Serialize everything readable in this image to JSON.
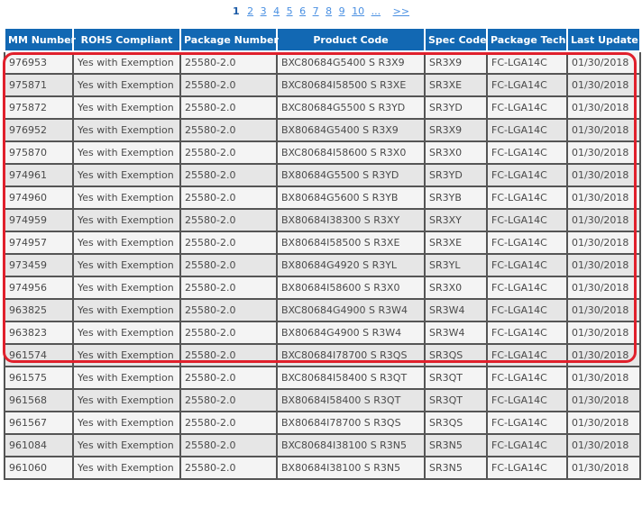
{
  "pagination": {
    "current": "1",
    "pages": [
      "2",
      "3",
      "4",
      "5",
      "6",
      "7",
      "8",
      "9",
      "10"
    ],
    "ellipsis": "...",
    "next": ">>"
  },
  "table": {
    "headers": [
      "MM Number",
      "ROHS Compliant",
      "Package Number",
      "Product Code",
      "Spec Code",
      "Package Tech",
      "Last Update"
    ],
    "rows": [
      [
        "976953",
        "Yes with Exemption",
        "25580-2.0",
        "BXC80684G5400 S R3X9",
        "SR3X9",
        "FC-LGA14C",
        "01/30/2018"
      ],
      [
        "975871",
        "Yes with Exemption",
        "25580-2.0",
        "BXC80684I58500 S R3XE",
        "SR3XE",
        "FC-LGA14C",
        "01/30/2018"
      ],
      [
        "975872",
        "Yes with Exemption",
        "25580-2.0",
        "BXC80684G5500 S R3YD",
        "SR3YD",
        "FC-LGA14C",
        "01/30/2018"
      ],
      [
        "976952",
        "Yes with Exemption",
        "25580-2.0",
        "BX80684G5400 S R3X9",
        "SR3X9",
        "FC-LGA14C",
        "01/30/2018"
      ],
      [
        "975870",
        "Yes with Exemption",
        "25580-2.0",
        "BXC80684I58600 S R3X0",
        "SR3X0",
        "FC-LGA14C",
        "01/30/2018"
      ],
      [
        "974961",
        "Yes with Exemption",
        "25580-2.0",
        "BX80684G5500 S R3YD",
        "SR3YD",
        "FC-LGA14C",
        "01/30/2018"
      ],
      [
        "974960",
        "Yes with Exemption",
        "25580-2.0",
        "BX80684G5600 S R3YB",
        "SR3YB",
        "FC-LGA14C",
        "01/30/2018"
      ],
      [
        "974959",
        "Yes with Exemption",
        "25580-2.0",
        "BX80684I38300 S R3XY",
        "SR3XY",
        "FC-LGA14C",
        "01/30/2018"
      ],
      [
        "974957",
        "Yes with Exemption",
        "25580-2.0",
        "BX80684I58500 S R3XE",
        "SR3XE",
        "FC-LGA14C",
        "01/30/2018"
      ],
      [
        "973459",
        "Yes with Exemption",
        "25580-2.0",
        "BX80684G4920 S R3YL",
        "SR3YL",
        "FC-LGA14C",
        "01/30/2018"
      ],
      [
        "974956",
        "Yes with Exemption",
        "25580-2.0",
        "BX80684I58600 S R3X0",
        "SR3X0",
        "FC-LGA14C",
        "01/30/2018"
      ],
      [
        "963825",
        "Yes with Exemption",
        "25580-2.0",
        "BXC80684G4900 S R3W4",
        "SR3W4",
        "FC-LGA14C",
        "01/30/2018"
      ],
      [
        "963823",
        "Yes with Exemption",
        "25580-2.0",
        "BX80684G4900 S R3W4",
        "SR3W4",
        "FC-LGA14C",
        "01/30/2018"
      ],
      [
        "961574",
        "Yes with Exemption",
        "25580-2.0",
        "BXC80684I78700 S R3QS",
        "SR3QS",
        "FC-LGA14C",
        "01/30/2018"
      ],
      [
        "961575",
        "Yes with Exemption",
        "25580-2.0",
        "BXC80684I58400 S R3QT",
        "SR3QT",
        "FC-LGA14C",
        "01/30/2018"
      ],
      [
        "961568",
        "Yes with Exemption",
        "25580-2.0",
        "BX80684I58400 S R3QT",
        "SR3QT",
        "FC-LGA14C",
        "01/30/2018"
      ],
      [
        "961567",
        "Yes with Exemption",
        "25580-2.0",
        "BX80684I78700 S R3QS",
        "SR3QS",
        "FC-LGA14C",
        "01/30/2018"
      ],
      [
        "961084",
        "Yes with Exemption",
        "25580-2.0",
        "BXC80684I38100 S R3N5",
        "SR3N5",
        "FC-LGA14C",
        "01/30/2018"
      ],
      [
        "961060",
        "Yes with Exemption",
        "25580-2.0",
        "BX80684I38100 S R3N5",
        "SR3N5",
        "FC-LGA14C",
        "01/30/2018"
      ]
    ]
  },
  "highlight": {
    "color": "#e0202c",
    "rows_covered": 13
  },
  "colors": {
    "header_bg": "#1268b3",
    "header_text": "#ffffff",
    "row_odd": "#f4f4f4",
    "row_even": "#e6e6e6",
    "link": "#4a90e2"
  }
}
